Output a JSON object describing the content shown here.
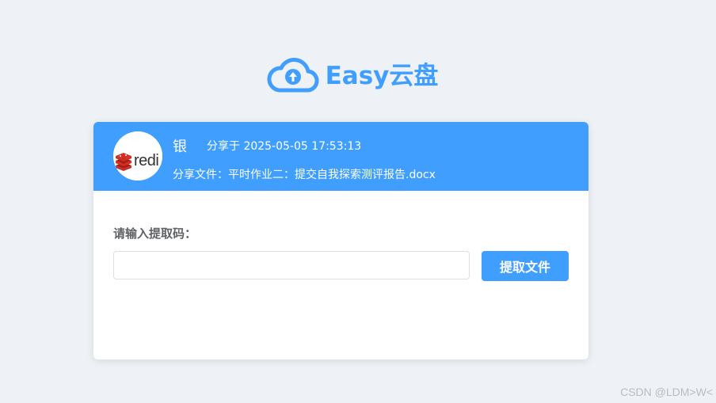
{
  "brand": {
    "name": "Easy云盘",
    "color": "#409eff",
    "icon": "cloud-upload-icon"
  },
  "share": {
    "user_name": "银",
    "share_time": "分享于 2025-05-05 17:53:13",
    "file_line": "分享文件：平时作业二：提交自我探索测评报告.docx",
    "avatar": {
      "text": "redi",
      "icon": "redis-logo-icon"
    }
  },
  "form": {
    "code_label": "请输入提取码：",
    "code_value": "",
    "code_placeholder": "",
    "submit_label": "提取文件"
  },
  "watermark": "CSDN @LDM>W<"
}
